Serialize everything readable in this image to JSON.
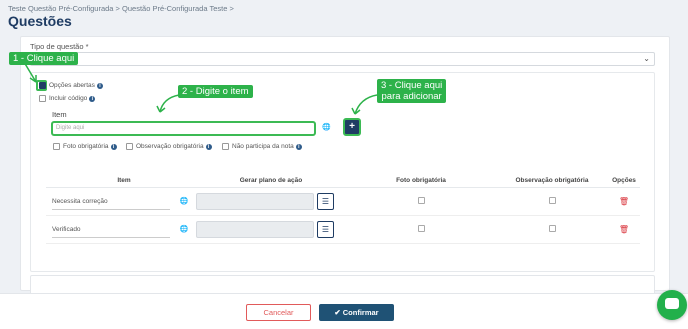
{
  "breadcrumb": "Teste Questão Pré-Configurada > Questão Pré-Configurada Teste >",
  "page_title": "Questões",
  "form": {
    "tipo_label": "Tipo de questão *",
    "tipo_value": "",
    "chevron": "⌄"
  },
  "options": {
    "opcoes_abertas": "Opções abertas",
    "incluir_codigo": "Incluir código"
  },
  "item": {
    "label": "Item",
    "placeholder": "Digite aqui",
    "add_symbol": "+",
    "foto_obrigatoria": "Foto obrigatória",
    "observacao_obrigatoria": "Observação obrigatória",
    "nao_participa": "Não participa da nota"
  },
  "callouts": {
    "c1": "1 - Clique aqui",
    "c2": "2 - Digite o item",
    "c3_line1": "3 - Clique aqui",
    "c3_line2": "para adicionar"
  },
  "table": {
    "headers": [
      "Item",
      "Gerar plano de ação",
      "Foto obrigatória",
      "Observação obrigatória",
      "Opções"
    ],
    "rows": [
      {
        "item": "Necessita correção"
      },
      {
        "item": "Verificado"
      }
    ]
  },
  "footer": {
    "cancel": "Cancelar",
    "confirm": "Confirmar"
  },
  "colors": {
    "primary": "#1f3c63",
    "callout_green": "#2db24a",
    "danger": "#d9343c"
  }
}
